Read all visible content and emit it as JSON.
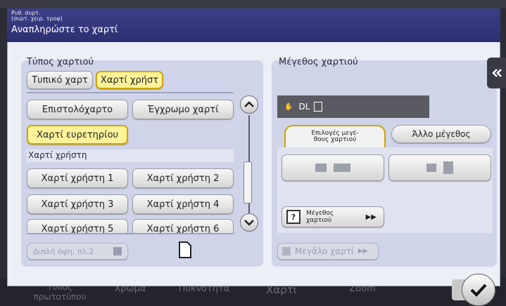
{
  "header": {
    "subtitle_line1": "Ρυθ. συρτ.",
    "subtitle_line2": "(συρτ. χειρ. τροφ)",
    "title": "Αναπληρώστε το χαρτί"
  },
  "paper_type": {
    "label": "Τύπος χαρτιού",
    "tabs": [
      "Τυπικό χαρτ",
      "Χαρτί χρήστ"
    ],
    "selected_tab": "Χαρτί χρήστ",
    "buttons": [
      "Επιστολόχαρτο",
      "Έγχρωμο χαρτί",
      "Χαρτί ευρετηρίου"
    ],
    "selected_button": "Χαρτί ευρετηρίου",
    "user_section_label": "Χαρτί χρήστη",
    "user_papers": [
      "Χαρτί χρήστη 1",
      "Χαρτί χρήστη 2",
      "Χαρτί χρήστη 3",
      "Χαρτί χρήστη 4",
      "Χαρτί χρήστη 5",
      "Χαρτί χρήστη 6"
    ],
    "duplex_label": "Διπλή όψη, πλ.2",
    "scroll_position": 0.6
  },
  "paper_size": {
    "label": "Μέγεθος χαρτιού",
    "current_size": "DL",
    "tabs": [
      "Επιλογές μεγέθους χαρτιού",
      "Άλλο μέγεθος"
    ],
    "tab0_line1": "Επιλογές μεγέ-",
    "tab0_line2": "θους χαρτιού",
    "size_button_line1": "Μέγεθος",
    "size_button_line2": "χαρτιού",
    "large_paper_label": "Μεγάλο χαρτί"
  },
  "background_tabs": [
    "Τύπος πρωτοτύπου",
    "Χρώμα",
    "Πυκνότητα",
    "Χαρτί",
    "Zoom"
  ],
  "bg_tab0_line1": "Τύπος",
  "bg_tab0_line2": "πρωτοτύπου",
  "icons": [
    "collapse-arrow-icon",
    "scroll-up-icon",
    "scroll-down-icon",
    "document-icon",
    "hand-icon",
    "paper-size-icon",
    "double-arrow-icon",
    "checkmark-icon"
  ],
  "colors": {
    "header": "#3b3f86",
    "selected": "#fff39a",
    "selected_border": "#d1a400",
    "panel": "#cfd4e8"
  }
}
